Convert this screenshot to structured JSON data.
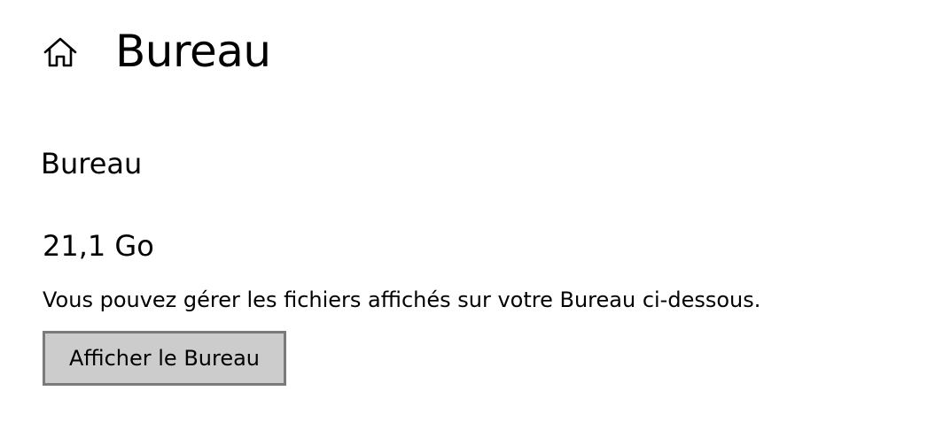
{
  "header": {
    "home_icon": "home-icon",
    "title": "Bureau"
  },
  "section": {
    "heading": "Bureau",
    "size": "21,1 Go",
    "description": "Vous pouvez gérer les fichiers affichés sur votre Bureau ci-dessous.",
    "button_label": "Afficher le Bureau"
  },
  "colors": {
    "background": "#ffffff",
    "text": "#000000",
    "button_background": "#cccccc",
    "button_border": "#7a7a7a"
  }
}
